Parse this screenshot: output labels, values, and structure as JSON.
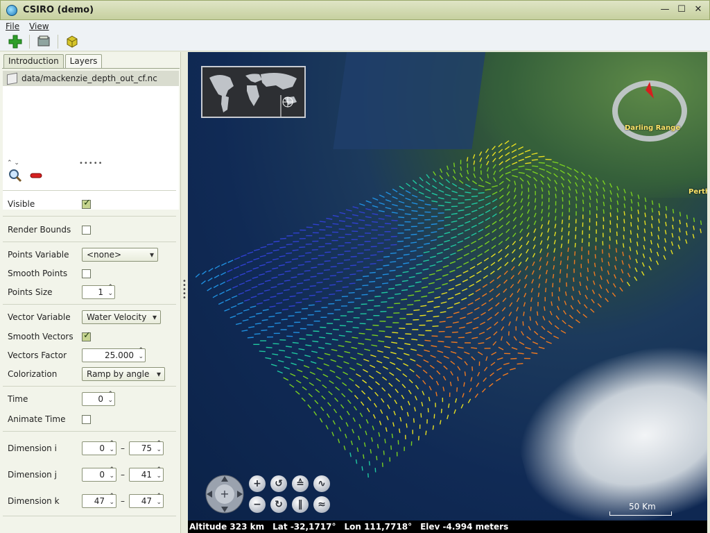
{
  "window": {
    "title": "CSIRO (demo)",
    "minimize": "—",
    "maximize": "☐",
    "close": "✕"
  },
  "menu": {
    "file": "File",
    "view": "View"
  },
  "toolbar": {
    "icons": [
      "add-icon",
      "open-layer-icon",
      "cube-icon"
    ]
  },
  "tabs": {
    "introduction": "Introduction",
    "layers": "Layers"
  },
  "layers": [
    {
      "label": "data/mackenzie_depth_out_cf.nc"
    }
  ],
  "properties": {
    "visible": {
      "label": "Visible",
      "checked": true
    },
    "render_bounds": {
      "label": "Render Bounds",
      "checked": false
    },
    "points_variable": {
      "label": "Points Variable",
      "value": "<none>"
    },
    "smooth_points": {
      "label": "Smooth Points",
      "checked": false
    },
    "points_size": {
      "label": "Points Size",
      "value": "1"
    },
    "vector_variable": {
      "label": "Vector Variable",
      "value": "Water Velocity"
    },
    "smooth_vectors": {
      "label": "Smooth Vectors",
      "checked": true
    },
    "vectors_factor": {
      "label": "Vectors Factor",
      "value": "25.000"
    },
    "colorization": {
      "label": "Colorization",
      "value": "Ramp by angle"
    },
    "time": {
      "label": "Time",
      "value": "0"
    },
    "animate_time": {
      "label": "Animate Time",
      "checked": false
    },
    "dimension_i": {
      "label": "Dimension i",
      "from": "0",
      "to": "75"
    },
    "dimension_j": {
      "label": "Dimension j",
      "from": "0",
      "to": "41"
    },
    "dimension_k": {
      "label": "Dimension k",
      "from": "47",
      "to": "47"
    },
    "range_sep": "–"
  },
  "globe": {
    "place_labels": {
      "darling_range": "Darling Range",
      "perth": "Perth"
    },
    "scale": "50 Km"
  },
  "status": {
    "altitude": "Altitude 323 km",
    "lat": "Lat -32,1717°",
    "lon": "Lon 111,7718°",
    "elev": "Elev -4.994 meters"
  },
  "colors": {
    "accent": "#c6d490",
    "titlebar": "#c6d09f",
    "ocean": "#102a55"
  }
}
